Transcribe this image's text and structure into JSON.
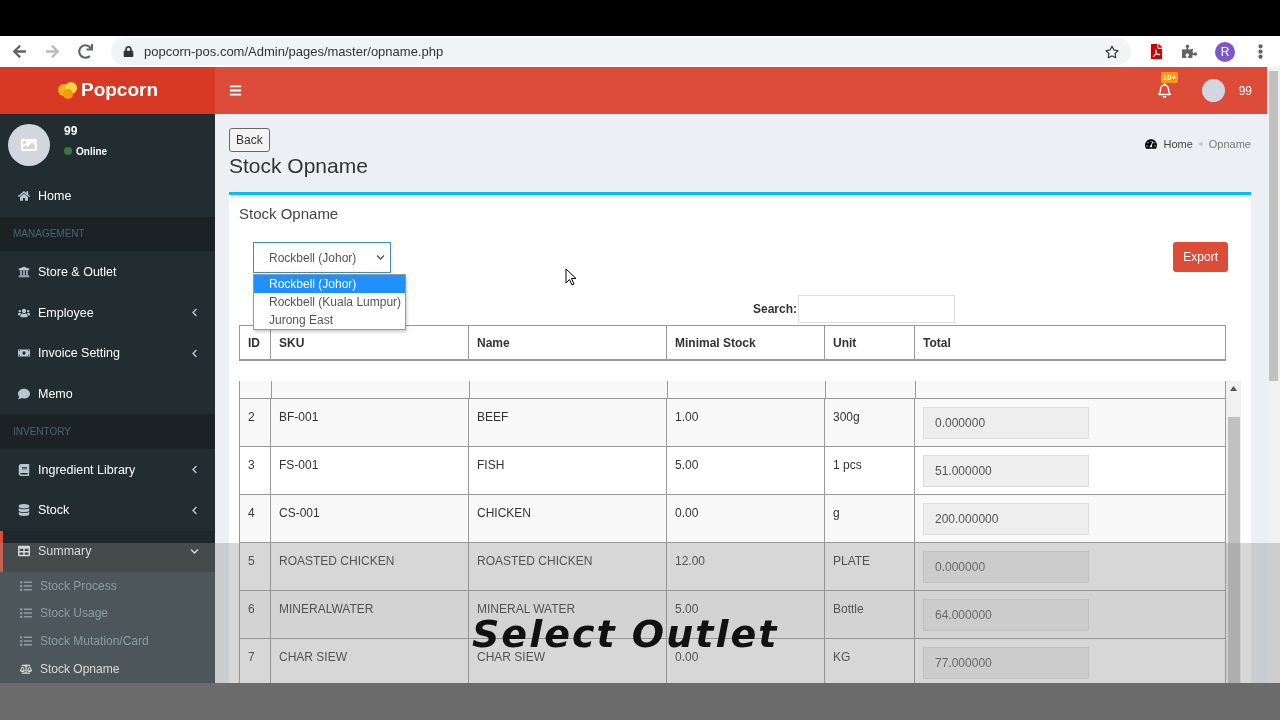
{
  "browser": {
    "url": "popcorn-pos.com/Admin/pages/master/opname.php",
    "profile_initial": "R"
  },
  "header": {
    "brand": "Popcorn",
    "notification_badge": "10+",
    "user_name": "99"
  },
  "sidebar": {
    "user": {
      "name": "99",
      "status": "Online"
    },
    "items": [
      {
        "kind": "item",
        "label": "Home",
        "selected": false
      },
      {
        "kind": "header",
        "label": "MANAGEMENT"
      },
      {
        "kind": "item",
        "label": "Store & Outlet",
        "selected": false
      },
      {
        "kind": "item",
        "label": "Employee",
        "selected": false,
        "expanded": false
      },
      {
        "kind": "item",
        "label": "Invoice Setting",
        "selected": false,
        "expanded": false
      },
      {
        "kind": "item",
        "label": "Memo",
        "selected": false
      },
      {
        "kind": "header",
        "label": "INVENTORY"
      },
      {
        "kind": "item",
        "label": "Ingredient Library",
        "selected": false,
        "expanded": false
      },
      {
        "kind": "item",
        "label": "Stock",
        "selected": false,
        "expanded": false
      },
      {
        "kind": "item",
        "label": "Summary",
        "selected": true,
        "expanded": true,
        "children": [
          {
            "label": "Stock Process",
            "selected": false
          },
          {
            "label": "Stock Usage",
            "selected": false
          },
          {
            "label": "Stock Mutation/Card",
            "selected": false
          },
          {
            "label": "Stock Opname",
            "selected": true
          }
        ]
      }
    ]
  },
  "page": {
    "back": "Back",
    "title": "Stock Opname",
    "breadcrumb": [
      "Home",
      "Opname"
    ]
  },
  "card": {
    "title": "Stock Opname",
    "outlet_select": {
      "value": "Rockbell (Johor)",
      "options": [
        {
          "label": "Rockbell (Johor)",
          "selected": true
        },
        {
          "label": "Rockbell (Kuala Lumpur)",
          "selected": false
        },
        {
          "label": "Jurong East",
          "selected": false
        }
      ]
    },
    "export": "Export",
    "search_label": "Search:",
    "columns": [
      "ID",
      "SKU",
      "Name",
      "Minimal Stock",
      "Unit",
      "Total"
    ],
    "rows": [
      {
        "id": "2",
        "sku": "BF-001",
        "name": "BEEF",
        "minimal_stock": "1.00",
        "unit": "300g",
        "total": "0.000000"
      },
      {
        "id": "3",
        "sku": "FS-001",
        "name": "FISH",
        "minimal_stock": "5.00",
        "unit": "1 pcs",
        "total": "51.000000"
      },
      {
        "id": "4",
        "sku": "CS-001",
        "name": "CHICKEN",
        "minimal_stock": "0.00",
        "unit": "g",
        "total": "200.000000"
      },
      {
        "id": "5",
        "sku": "ROASTED CHICKEN",
        "name": "ROASTED CHICKEN",
        "minimal_stock": "12.00",
        "unit": "PLATE",
        "total": "0.000000"
      },
      {
        "id": "6",
        "sku": "MINERALWATER",
        "name": "MINERAL WATER",
        "minimal_stock": "5.00",
        "unit": "Bottle",
        "total": "64.000000"
      },
      {
        "id": "7",
        "sku": "CHAR SIEW",
        "name": "CHAR SIEW",
        "minimal_stock": "0.00",
        "unit": "KG",
        "total": "77.000000"
      }
    ]
  },
  "caption": "Select Outlet"
}
